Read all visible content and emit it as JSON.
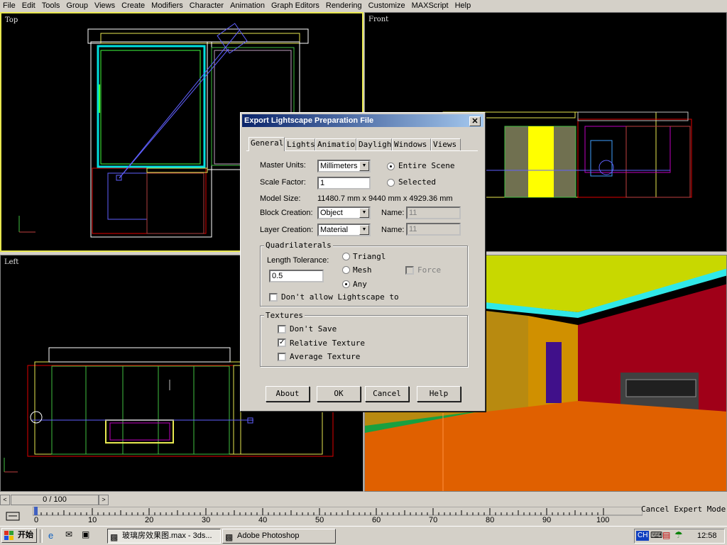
{
  "menu": [
    "File",
    "Edit",
    "Tools",
    "Group",
    "Views",
    "Create",
    "Modifiers",
    "Character",
    "Animation",
    "Graph Editors",
    "Rendering",
    "Customize",
    "MAXScript",
    "Help"
  ],
  "viewports": {
    "top": {
      "label": "Top"
    },
    "front": {
      "label": "Front"
    },
    "left": {
      "label": "Left"
    }
  },
  "dialog": {
    "title": "Export Lightscape Preparation File",
    "close_glyph": "✕",
    "tabs": [
      "General",
      "Lights",
      "Animation",
      "Daylight",
      "Windows",
      "Views"
    ],
    "master_units_label": "Master Units:",
    "master_units_value": "Millimeters",
    "scale_factor_label": "Scale Factor:",
    "scale_factor_value": "1",
    "model_size_label": "Model Size:",
    "model_size_value": "11480.7 mm x 9440 mm x 4929.36 mm",
    "block_creation_label": "Block Creation:",
    "block_creation_value": "Object",
    "layer_creation_label": "Layer Creation:",
    "layer_creation_value": "Material",
    "name_label": "Name:",
    "block_name_value": "11",
    "layer_name_value": "11",
    "scope_entire": "Entire Scene",
    "scope_selected": "Selected",
    "quadrilaterals": {
      "title": "Quadrilaterals",
      "length_tolerance_label": "Length Tolerance:",
      "length_tolerance_value": "0.5",
      "opt_triangle": "Triangl",
      "opt_mesh": "Mesh",
      "opt_any": "Any",
      "force_label": "Force",
      "dont_allow_label": "Don't allow Lightscape to"
    },
    "textures": {
      "title": "Textures",
      "dont_save": "Don't Save",
      "relative": "Relative Texture",
      "average": "Average Texture"
    },
    "buttons": {
      "about": "About",
      "ok": "OK",
      "cancel": "Cancel",
      "help": "Help"
    }
  },
  "timeslider": {
    "value": "0 / 100"
  },
  "timeline": {
    "ticks": [
      "0",
      "10",
      "20",
      "30",
      "40",
      "50",
      "60",
      "70",
      "80",
      "90",
      "100"
    ]
  },
  "status": {
    "text": "Cancel Expert Mode"
  },
  "taskbar": {
    "start_label": "开始",
    "tasks": [
      "玻璃房效果图.max - 3ds...",
      "Adobe Photoshop"
    ],
    "tray_lang": "CH",
    "clock": "12:58"
  }
}
